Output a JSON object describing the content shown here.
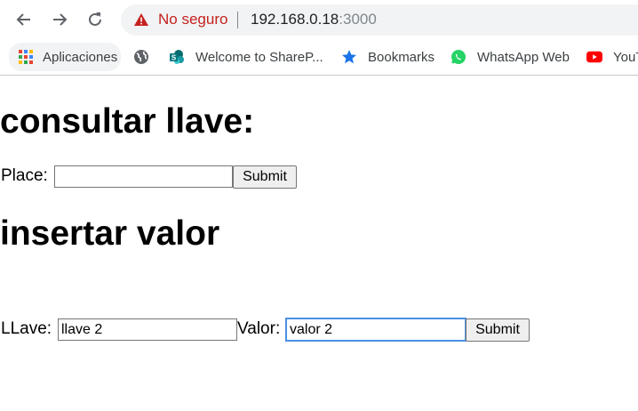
{
  "browser": {
    "back_icon": "arrow-left-icon",
    "forward_icon": "arrow-right-icon",
    "reload_icon": "reload-icon",
    "security_label": "No seguro",
    "url_host": "192.168.0.18",
    "url_port": ":3000"
  },
  "bookmarks": [
    {
      "label": "Aplicaciones",
      "icon": "apps-grid-icon"
    },
    {
      "label": "",
      "icon": "globe-icon"
    },
    {
      "label": "Welcome to ShareP...",
      "icon": "sharepoint-icon"
    },
    {
      "label": "Bookmarks",
      "icon": "star-icon"
    },
    {
      "label": "WhatsApp Web",
      "icon": "whatsapp-icon"
    },
    {
      "label": "YouT",
      "icon": "youtube-icon"
    }
  ],
  "page": {
    "consult_heading": "consultar llave:",
    "place_label": "Place:",
    "place_value": "",
    "consult_submit": "Submit",
    "insert_heading": "insertar valor",
    "llave_label": "LLave:",
    "llave_value": "llave 2",
    "valor_label": "Valor:",
    "valor_value": "valor 2",
    "insert_submit": "Submit"
  }
}
